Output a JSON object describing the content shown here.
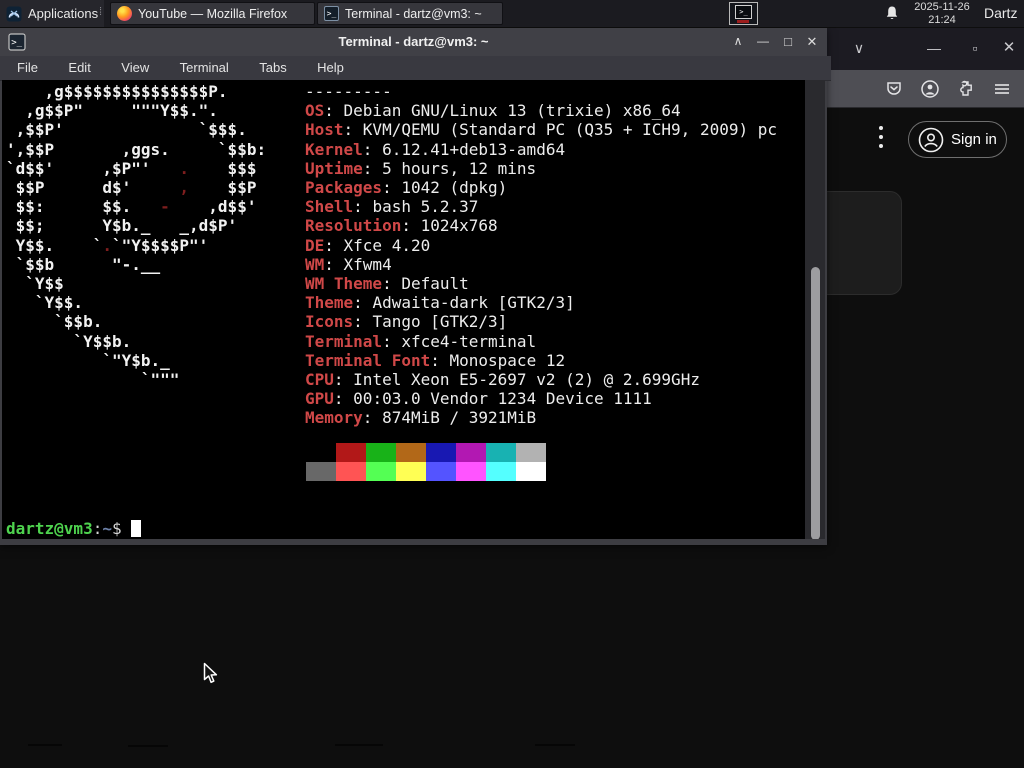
{
  "colors": {
    "label_red": "#d04848",
    "art_red": "#7e1e1e",
    "art_white": "#f2f2f2",
    "prompt_green": "#4ed24e",
    "prompt_blue": "#6c80a8"
  },
  "panel": {
    "applications_label": "Applications",
    "handle_glyph": "⁞",
    "tasks": [
      {
        "label": "YouTube — Mozilla Firefox"
      },
      {
        "label": "Terminal - dartz@vm3: ~"
      }
    ],
    "clock_date": "2025-11-26",
    "clock_time": "21:24",
    "user_label": "Dartz"
  },
  "terminal_window": {
    "title": "Terminal - dartz@vm3: ~",
    "icon_glyph": ">_",
    "menu_items": [
      "File",
      "Edit",
      "View",
      "Terminal",
      "Tabs",
      "Help"
    ],
    "controls": {
      "shade": "∧",
      "minimize": "—",
      "maximize": "□",
      "close": "✕"
    },
    "neofetch": {
      "ascii_art_lines": [
        "    ,g$$$$$$$$$$$$$$$P.",
        "  ,g$$P\"     \"\"\"Y$$.\".",
        " ,$$P'              `$$$.",
        "',$$P       ,ggs.     `$$b:",
        "`d$$'     ,$P\"'        $$$",
        " $$P      d$'          $$P",
        " $$:      $$.        ,d$$'",
        " $$;      Y$b._   _,d$P'",
        " Y$$.    ` `\"Y$$$$P\"'",
        " `$$b      \"-.__",
        "  `Y$$",
        "   `Y$$.",
        "     `$$b.",
        "       `Y$$b.",
        "          `\"Y$b._",
        "              `\"\"\""
      ],
      "ascii_art_red_lines": [
        "",
        "",
        "",
        "",
        "                  .",
        "                  ,",
        "                -",
        "",
        "          .",
        "",
        "",
        "",
        "",
        "",
        "",
        ""
      ],
      "info": [
        {
          "label": "",
          "value": "---------"
        },
        {
          "label": "OS",
          "value": ": Debian GNU/Linux 13 (trixie) x86_64"
        },
        {
          "label": "Host",
          "value": ": KVM/QEMU (Standard PC (Q35 + ICH9, 2009) pc"
        },
        {
          "label": "Kernel",
          "value": ": 6.12.41+deb13-amd64"
        },
        {
          "label": "Uptime",
          "value": ": 5 hours, 12 mins"
        },
        {
          "label": "Packages",
          "value": ": 1042 (dpkg)"
        },
        {
          "label": "Shell",
          "value": ": bash 5.2.37"
        },
        {
          "label": "Resolution",
          "value": ": 1024x768"
        },
        {
          "label": "DE",
          "value": ": Xfce 4.20"
        },
        {
          "label": "WM",
          "value": ": Xfwm4"
        },
        {
          "label": "WM Theme",
          "value": ": Default"
        },
        {
          "label": "Theme",
          "value": ": Adwaita-dark [GTK2/3]"
        },
        {
          "label": "Icons",
          "value": ": Tango [GTK2/3]"
        },
        {
          "label": "Terminal",
          "value": ": xfce4-terminal"
        },
        {
          "label": "Terminal Font",
          "value": ": Monospace 12"
        },
        {
          "label": "CPU",
          "value": ": Intel Xeon E5-2697 v2 (2) @ 2.699GHz"
        },
        {
          "label": "GPU",
          "value": ": 00:03.0 Vendor 1234 Device 1111"
        },
        {
          "label": "Memory",
          "value": ": 874MiB / 3921MiB"
        }
      ],
      "palette_row1": [
        "#000000",
        "#b21818",
        "#18b218",
        "#b26818",
        "#1818b2",
        "#b218b2",
        "#18b2b2",
        "#b2b2b2"
      ],
      "palette_row2": [
        "#686868",
        "#ff5454",
        "#54ff54",
        "#ffff54",
        "#5454ff",
        "#ff54ff",
        "#54ffff",
        "#ffffff"
      ]
    },
    "prompt": {
      "user_host": "dartz@vm3",
      "separator": ":",
      "path": "~",
      "symbol": "$"
    }
  },
  "firefox_window": {
    "controls": {
      "list_tabs": "∨",
      "minimize": "—",
      "maximize": "▫",
      "close": "✕"
    },
    "signin_label": "Sign in"
  }
}
